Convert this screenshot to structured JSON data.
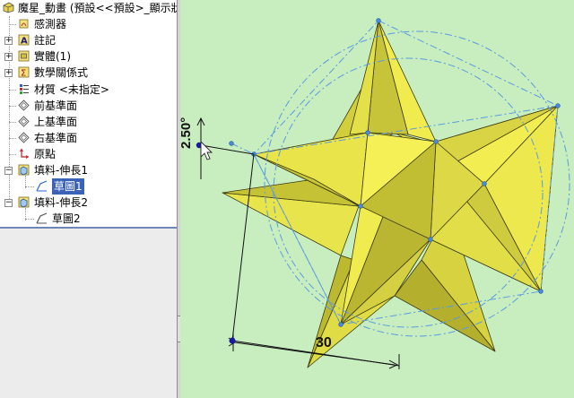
{
  "tree": {
    "root_label": "魔星_動畫  (預設<<預設>_顯示狀",
    "items": [
      {
        "label": "感測器",
        "icon": "sensor-icon"
      },
      {
        "label": "註記",
        "icon": "annotation-icon"
      },
      {
        "label": "實體(1)",
        "icon": "solid-body-icon"
      },
      {
        "label": "數學關係式",
        "icon": "equation-icon"
      },
      {
        "label": "材質 <未指定>",
        "icon": "material-icon"
      },
      {
        "label": "前基準面",
        "icon": "plane-icon"
      },
      {
        "label": "上基準面",
        "icon": "plane-icon"
      },
      {
        "label": "右基準面",
        "icon": "plane-icon"
      },
      {
        "label": "原點",
        "icon": "origin-icon"
      },
      {
        "label": "填料-伸長1",
        "icon": "extrude-icon"
      },
      {
        "label": "草圖1",
        "icon": "sketch-icon"
      },
      {
        "label": "填料-伸長2",
        "icon": "extrude-icon"
      },
      {
        "label": "草圖2",
        "icon": "sketch-icon"
      }
    ]
  },
  "sketch": {
    "dimension_angle": "2.50°",
    "dimension_length": "30"
  },
  "colors": {
    "viewport_bg": "#c8eec0",
    "star_face": "#f0ec50",
    "star_shade": "#b8b432",
    "construction_line": "#5a9ae0",
    "selection": "#3b62b8"
  }
}
